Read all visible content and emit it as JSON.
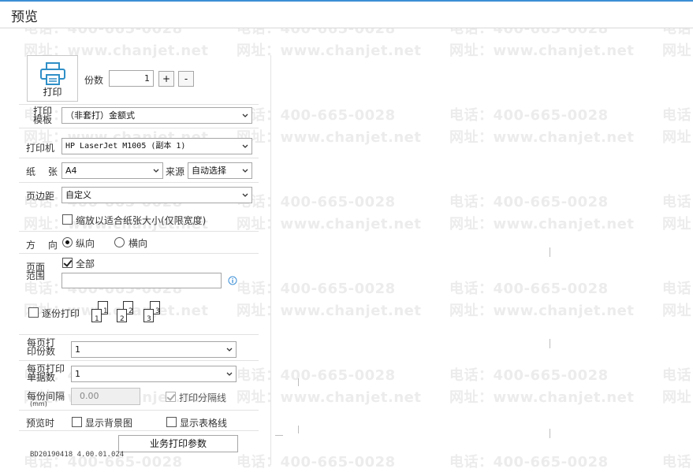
{
  "window": {
    "title": "预览"
  },
  "watermark": {
    "phone": "电话：400-665-0028",
    "site": "网址：www.chanjet.net"
  },
  "print_button": {
    "label": "打印",
    "icon": "printer-icon"
  },
  "copies": {
    "label": "份数",
    "value": "1",
    "plus": "+",
    "minus": "-"
  },
  "template": {
    "label": "打印模板",
    "value": "（非套打）金额式"
  },
  "printer": {
    "label": "打印机",
    "value": "HP LaserJet M1005 (副本 1)"
  },
  "paper": {
    "label": "纸 张",
    "value": "A4",
    "source_label": "来源",
    "source_value": "自动选择"
  },
  "margin": {
    "label": "页边距",
    "value": "自定义"
  },
  "fit_paper": {
    "label": "缩放以适合纸张大小(仅限宽度)",
    "checked": false
  },
  "orientation": {
    "label": "方 向",
    "portrait": "纵向",
    "landscape": "横向",
    "selected": "portrait"
  },
  "page_range": {
    "label": "页面范围",
    "all_label": "全部",
    "all_checked": true,
    "custom_value": ""
  },
  "collate": {
    "label": "逐份打印",
    "checked": false,
    "pages": [
      "1",
      "2",
      "3"
    ]
  },
  "copies_per_page": {
    "label": "每页打印份数",
    "value": "1"
  },
  "docs_per_page": {
    "label": "每页打印单据数",
    "value": "1"
  },
  "spacing": {
    "label": "每份间隔",
    "unit": "(mm)",
    "value": "0.00",
    "divider_label": "打印分隔线",
    "divider_checked": true
  },
  "preview_opts": {
    "label": "预览时",
    "show_bg": "显示背景图",
    "show_grid": "显示表格线"
  },
  "business_params": {
    "label": "业务打印参数"
  },
  "version": "BD20190418 4.00.01.024",
  "colors": {
    "accent": "#3c8fd6",
    "printer_icon": "#2f8fc7"
  }
}
